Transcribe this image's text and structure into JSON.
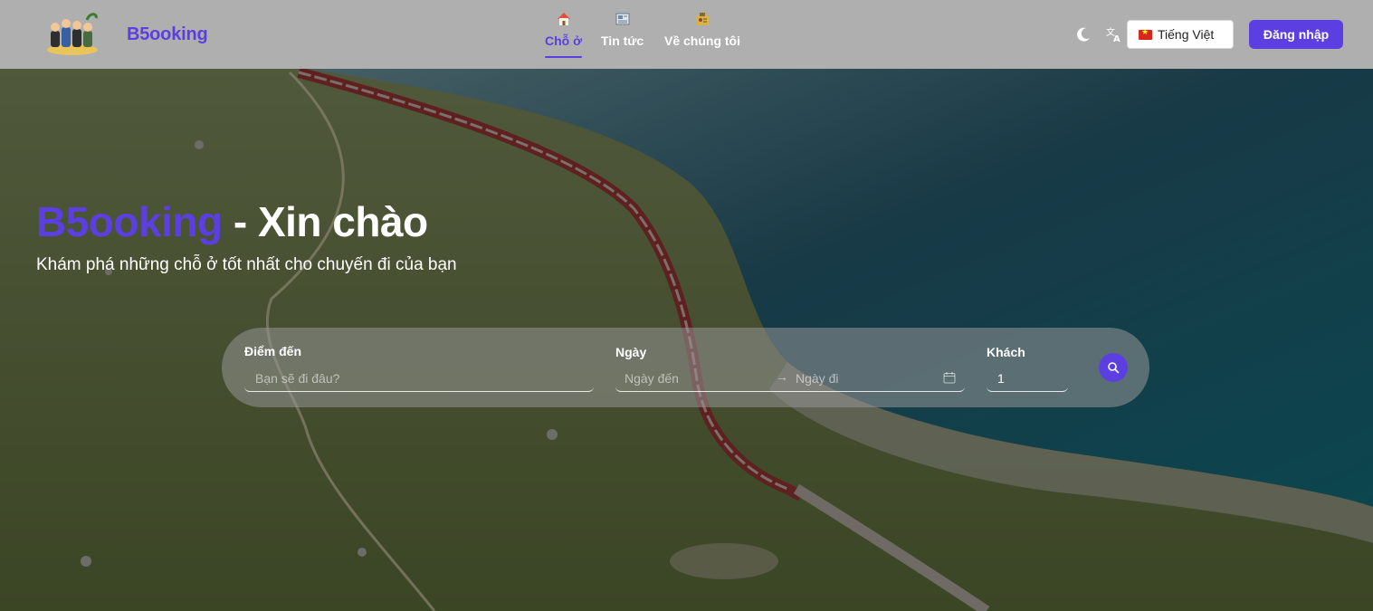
{
  "header": {
    "brand": "B5ooking",
    "nav": [
      {
        "label": "Chỗ ở",
        "icon": "house-icon",
        "active": true
      },
      {
        "label": "Tin tức",
        "icon": "newspaper-icon",
        "active": false
      },
      {
        "label": "Về chúng tôi",
        "icon": "badge-icon",
        "active": false
      }
    ],
    "language": "Tiếng Việt",
    "login_label": "Đăng nhập"
  },
  "hero": {
    "title_accent": "B5ooking",
    "title_rest": " - Xin chào",
    "subtitle": "Khám phá những chỗ ở tốt nhất cho chuyến đi của bạn"
  },
  "search": {
    "destination_label": "Điểm đến",
    "destination_placeholder": "Bạn sẽ đi đâu?",
    "date_label": "Ngày",
    "checkin_placeholder": "Ngày đến",
    "checkout_placeholder": "Ngày đi",
    "guests_label": "Khách",
    "guests_value": "1"
  },
  "colors": {
    "accent": "#5b3fe0",
    "header_bg": "#b2b2b2"
  }
}
